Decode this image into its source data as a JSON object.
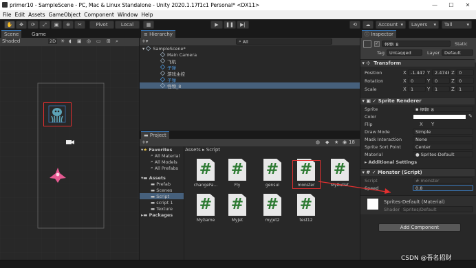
{
  "window": {
    "title": "primer10 - SampleScene - PC, Mac & Linux Standalone - Unity 2020.1.17f1c1 Personal* <DX11>",
    "minimize": "—",
    "maximize": "☐",
    "close": "✕"
  },
  "menu": [
    "File",
    "Edit",
    "Assets",
    "GameObject",
    "Component",
    "Window",
    "Help"
  ],
  "toolbar": {
    "pivot": "Pivot",
    "local": "Local",
    "account": "Account",
    "layers": "Layers",
    "layout": "Tall"
  },
  "scene": {
    "tab_scene": "Scene",
    "tab_game": "Game",
    "shading": "Shaded",
    "mode_2d": "2D"
  },
  "hierarchy": {
    "tab": "Hierarchy",
    "add": "+▾",
    "search": "All",
    "scene_name": "SampleScene*",
    "items": [
      {
        "label": "Main Camera",
        "style": "normal"
      },
      {
        "label": "飞机",
        "style": "normal"
      },
      {
        "label": "子弹",
        "style": "blue"
      },
      {
        "label": "游戏主控",
        "style": "normal"
      },
      {
        "label": "子弹",
        "style": "blue"
      },
      {
        "label": "怪物_8",
        "style": "selected"
      }
    ]
  },
  "project": {
    "tab": "Project",
    "add": "+▾",
    "breadcrumb_root": "Assets",
    "breadcrumb_leaf": "Script",
    "hidden_count": "18",
    "favorites": {
      "label": "Favorites",
      "items": [
        "All Material",
        "All Models",
        "All Prefabs"
      ]
    },
    "assets": {
      "label": "Assets",
      "items": [
        "Prefab",
        "Scenes",
        "Script",
        "script 1",
        "Texture"
      ]
    },
    "packages": "Packages",
    "files": [
      "changeFa...",
      "Fly",
      "gensui",
      "monster",
      "MyBullet",
      "MyGame",
      "MyJet",
      "myjet2",
      "test12"
    ]
  },
  "inspector": {
    "tab": "Inspector",
    "object_name": "怪物_8",
    "static": "Static",
    "tag_label": "Tag",
    "tag": "Untagged",
    "layer_label": "Layer",
    "layer": "Default",
    "transform": {
      "title": "Transform",
      "position_label": "Position",
      "rotation_label": "Rotation",
      "scale_label": "Scale",
      "x": "X",
      "y": "Y",
      "z": "Z",
      "position": [
        "-1.4476",
        "2.4748",
        "0"
      ],
      "rotation": [
        "0",
        "0",
        "0"
      ],
      "scale": [
        "1",
        "1",
        "1"
      ]
    },
    "sprite_renderer": {
      "title": "Sprite Renderer",
      "sprite_label": "Sprite",
      "sprite": "怪物_8",
      "color_label": "Color",
      "flip_label": "Flip",
      "flip_x": "X",
      "flip_y": "Y",
      "draw_mode_label": "Draw Mode",
      "draw_mode": "Simple",
      "mask_label": "Mask Interaction",
      "mask": "None",
      "sort_label": "Sprite Sort Point",
      "sort": "Center",
      "material_label": "Material",
      "material": "Sprites-Default",
      "additional": "Additional Settings"
    },
    "monster_script": {
      "title": "Monster (Script)",
      "script_label": "Script",
      "script": "monster",
      "speed_label": "Speed",
      "speed": "0.8"
    },
    "material": {
      "name": "Sprites-Default (Material)",
      "shader_label": "Shader",
      "shader": "Sprites/Default"
    },
    "add_component": "Add Component"
  },
  "watermark": "CSDN @吾名招财",
  "colors": {
    "accent": "#3a79bb",
    "selection": "#46607c",
    "annotation": "#e53030",
    "script_hash": "#2d7a32"
  }
}
